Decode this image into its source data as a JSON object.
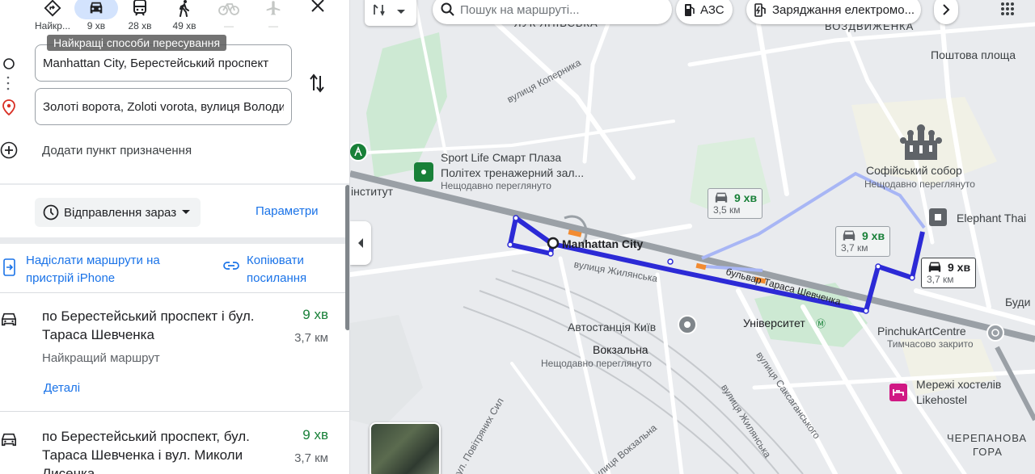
{
  "travel_modes": [
    {
      "label": "Найкр...",
      "icon": "best-route-icon"
    },
    {
      "label": "9 хв",
      "icon": "car-icon",
      "active": true
    },
    {
      "label": "28 хв",
      "icon": "transit-icon"
    },
    {
      "label": "49 хв",
      "icon": "walk-icon"
    },
    {
      "label": "—",
      "icon": "bike-icon",
      "disabled": true
    },
    {
      "label": "—",
      "icon": "flight-icon",
      "disabled": true
    }
  ],
  "tooltip": "Найкращі способи пересування",
  "origin": "Manhattan City, Берестейський проспект",
  "destination": "Золоті ворота, Zoloti vorota, вулиця Володимирська",
  "add_destination": "Додати пункт призначення",
  "depart": "Відправлення зараз",
  "params": "Параметри",
  "send_to_phone": "Надіслати маршрути на пристрій iPhone",
  "copy_link": "Копіювати посилання",
  "routes": [
    {
      "title": "по Берестейський проспект і бул. Тараса Шевченка",
      "time": "9 хв",
      "distance": "3,7 км",
      "note": "Найкращий маршрут",
      "details": "Деталі"
    },
    {
      "title": "по Берестейський проспект, бул. Тараса Шевченка і вул. Миколи Лисенка",
      "time": "9 хв",
      "distance": "3,7 км"
    }
  ],
  "map": {
    "search_placeholder": "Пошук на маршруті...",
    "chips": [
      "АЗС",
      "Заряджання електромо..."
    ],
    "labels": {
      "lukyanivska": "ЛУК'ЯНІВСЬКА",
      "vozdvyzhenka": "ВОЗДВИЖЕНКА",
      "poshtova": "Поштова площа",
      "sportlife_1": "Sport Life Смарт Плаза",
      "sportlife_2": "Політех тренажерний зал...",
      "recent": "Нещодавно переглянуто",
      "institute": "інститут",
      "sofia": "Софійський собор",
      "elephant": "Elephant Thai",
      "manhattan": "Manhattan City",
      "avtostantsia": "Автостанція Київ",
      "universytet": "Університет",
      "pinchuk": "PinchukArtCentre",
      "pinchuk_sub": "Тимчасово закрито",
      "vokzalna": "Вокзальна",
      "hostel_1": "Мережі хостелів",
      "hostel_2": "Likehostel",
      "budy": "Буди",
      "cherepanova": "ЧЕРЕПАНОВА",
      "hora": "ГОРА"
    },
    "streets": {
      "kopernyka": "вулиця Коперника",
      "zhylianska": "вулиця Жилянська",
      "shevchenka": "бульвар Тараса Шевченка",
      "saksahanskoho": "вулиця Саксаганського",
      "zhylianska2": "вулиця Жилянська",
      "povitrianykh": "вул. Повітряних Сил",
      "vokzalna_st": "вулиця Вокзальна"
    },
    "callouts": [
      {
        "time": "9 хв",
        "distance": "3,5 км"
      },
      {
        "time": "9 хв",
        "distance": "3,7 км"
      },
      {
        "time": "9 хв",
        "distance": "3,7 км"
      }
    ],
    "colors": {
      "route": "#2c2ad6",
      "route_alt": "#a8b6f5",
      "transit_green": "#188038"
    }
  }
}
